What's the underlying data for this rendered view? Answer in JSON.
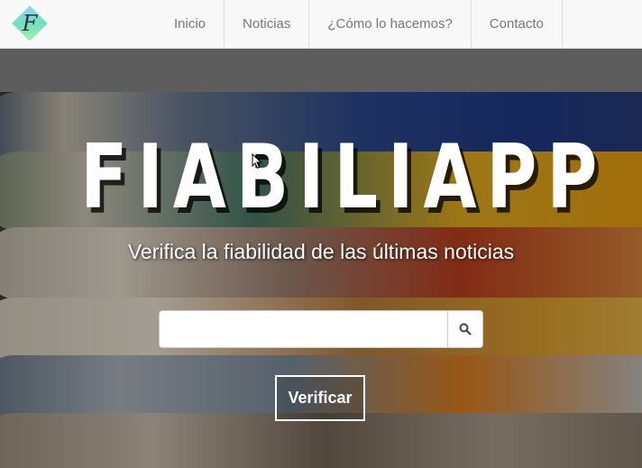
{
  "brand": {
    "logo_letter": "F",
    "logo_colors": [
      "#8fd3f4",
      "#6fe0c0",
      "#a8f0b0"
    ]
  },
  "nav": {
    "items": [
      {
        "label": "Inicio"
      },
      {
        "label": "Noticias"
      },
      {
        "label": "¿Cómo lo hacemos?"
      },
      {
        "label": "Contacto"
      }
    ]
  },
  "hero": {
    "title": "FIABILIAPP",
    "subtitle": "Verifica la fiabilidad de las últimas noticias",
    "search": {
      "value": "",
      "placeholder": ""
    },
    "verify_label": "Verificar"
  },
  "colors": {
    "navbar_bg": "#f8f8f8",
    "nav_text": "#777777",
    "hero_text": "#ffffff"
  }
}
